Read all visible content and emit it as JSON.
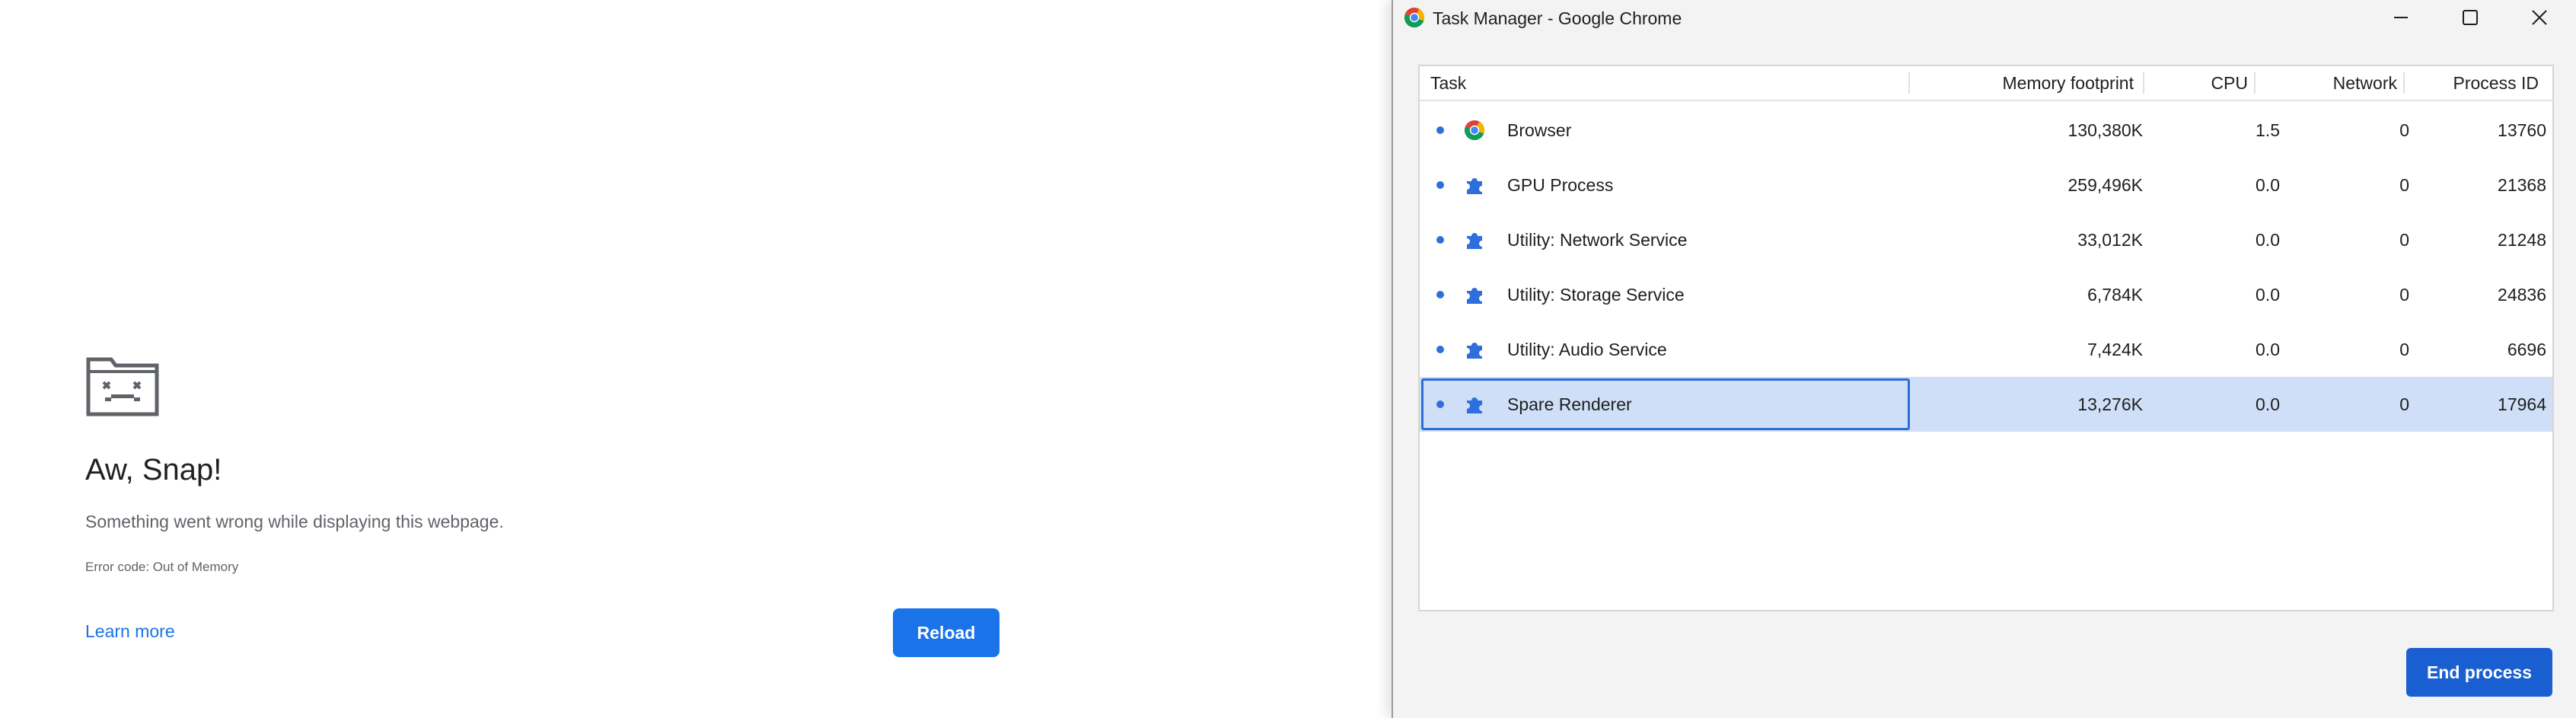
{
  "crash_page": {
    "title": "Aw, Snap!",
    "message": "Something went wrong while displaying this webpage.",
    "error_code": "Error code: Out of Memory",
    "learn_more": "Learn more",
    "reload_label": "Reload",
    "icon": "sad-tab-icon"
  },
  "task_manager": {
    "window_title": "Task Manager - Google Chrome",
    "window_icon": "chrome-logo-icon",
    "columns": {
      "task": "Task",
      "memory": "Memory footprint",
      "cpu": "CPU",
      "network": "Network",
      "pid": "Process ID"
    },
    "rows": [
      {
        "task": "Browser",
        "icon": "chrome-logo-icon",
        "memory": "130,380K",
        "cpu": "1.5",
        "network": "0",
        "pid": "13760"
      },
      {
        "task": "GPU Process",
        "icon": "puzzle-piece-icon",
        "memory": "259,496K",
        "cpu": "0.0",
        "network": "0",
        "pid": "21368"
      },
      {
        "task": "Utility: Network Service",
        "icon": "puzzle-piece-icon",
        "memory": "33,012K",
        "cpu": "0.0",
        "network": "0",
        "pid": "21248"
      },
      {
        "task": "Utility: Storage Service",
        "icon": "puzzle-piece-icon",
        "memory": "6,784K",
        "cpu": "0.0",
        "network": "0",
        "pid": "24836"
      },
      {
        "task": "Utility: Audio Service",
        "icon": "puzzle-piece-icon",
        "memory": "7,424K",
        "cpu": "0.0",
        "network": "0",
        "pid": "6696"
      },
      {
        "task": "Spare Renderer",
        "icon": "puzzle-piece-icon",
        "memory": "13,276K",
        "cpu": "0.0",
        "network": "0",
        "pid": "17964",
        "selected": true
      }
    ],
    "end_process_label": "End process"
  },
  "colors": {
    "accent": "#1a73e8",
    "selection": "#cfdff7",
    "selection_border": "#2b6fd3",
    "puzzle_icon": "#2f6fdb"
  }
}
